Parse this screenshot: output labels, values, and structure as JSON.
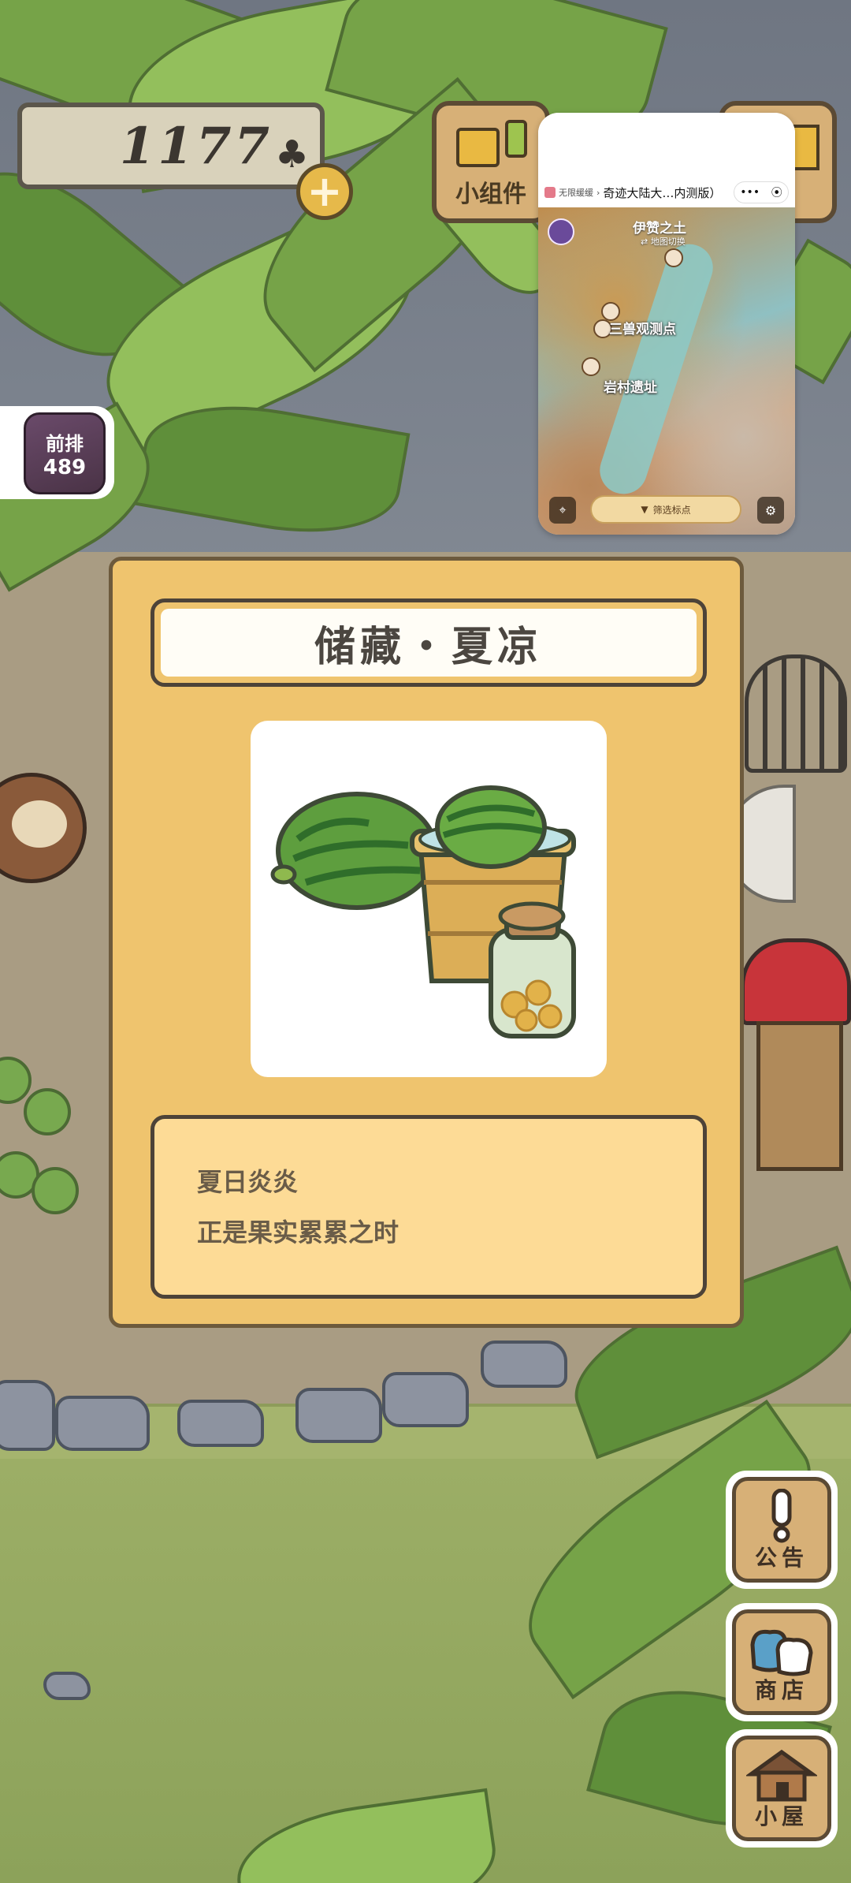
{
  "hud": {
    "currency_value": "1177",
    "currency_icon": "♣",
    "add_button": "+",
    "widget_label": "小组件"
  },
  "rank": {
    "label": "前排",
    "value": "489"
  },
  "mini_program": {
    "source": "无限缓缓",
    "title": "奇迹大陆大…内测版）",
    "capsule_more": "•••",
    "capsule_close": "⦿",
    "region": "伊赞之土",
    "switch_label": "⇄ 地图切换",
    "places": [
      "三兽观测点",
      "岩村遗址"
    ],
    "filter_label": "筛选标点"
  },
  "dialog": {
    "title": "储藏・夏凉",
    "image_alt": "watermelon-bucket-jar",
    "lines": [
      "夏日炎炎",
      "正是果实累累之时"
    ]
  },
  "side_buttons": [
    {
      "label": "公告",
      "icon": "exclamation-icon"
    },
    {
      "label": "商店",
      "icon": "bags-icon"
    },
    {
      "label": "小屋",
      "icon": "house-icon"
    }
  ],
  "colors": {
    "dialog_bg": "#efc46e",
    "dialog_desc_bg": "#fddb96",
    "button_wood": "#d7b077"
  }
}
